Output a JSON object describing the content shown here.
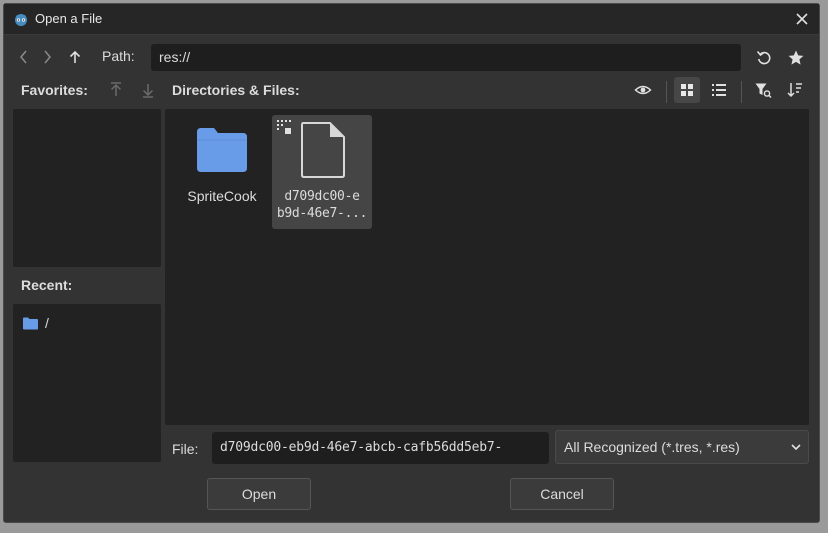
{
  "window": {
    "title": "Open a File"
  },
  "toolbar": {
    "path_label": "Path:",
    "path_value": "res://"
  },
  "favorites": {
    "label": "Favorites:"
  },
  "files_header": {
    "label": "Directories & Files:"
  },
  "files": [
    {
      "name": "SpriteCook",
      "type": "folder",
      "icon": "folder-icon"
    },
    {
      "name_line1": "d709dc00-e",
      "name_line2": "b9d-46e7-...",
      "type": "file",
      "icon": "file-icon",
      "selected": true
    }
  ],
  "recent": {
    "label": "Recent:",
    "items": [
      {
        "label": "/"
      }
    ]
  },
  "footer": {
    "file_label": "File:",
    "file_value": "d709dc00-eb9d-46e7-abcb-cafb56dd5eb7-",
    "filter_value": "All Recognized (*.tres, *.res)",
    "open_label": "Open",
    "cancel_label": "Cancel"
  },
  "colors": {
    "folder": "#699ce8",
    "panel": "#222222",
    "background": "#333333"
  }
}
